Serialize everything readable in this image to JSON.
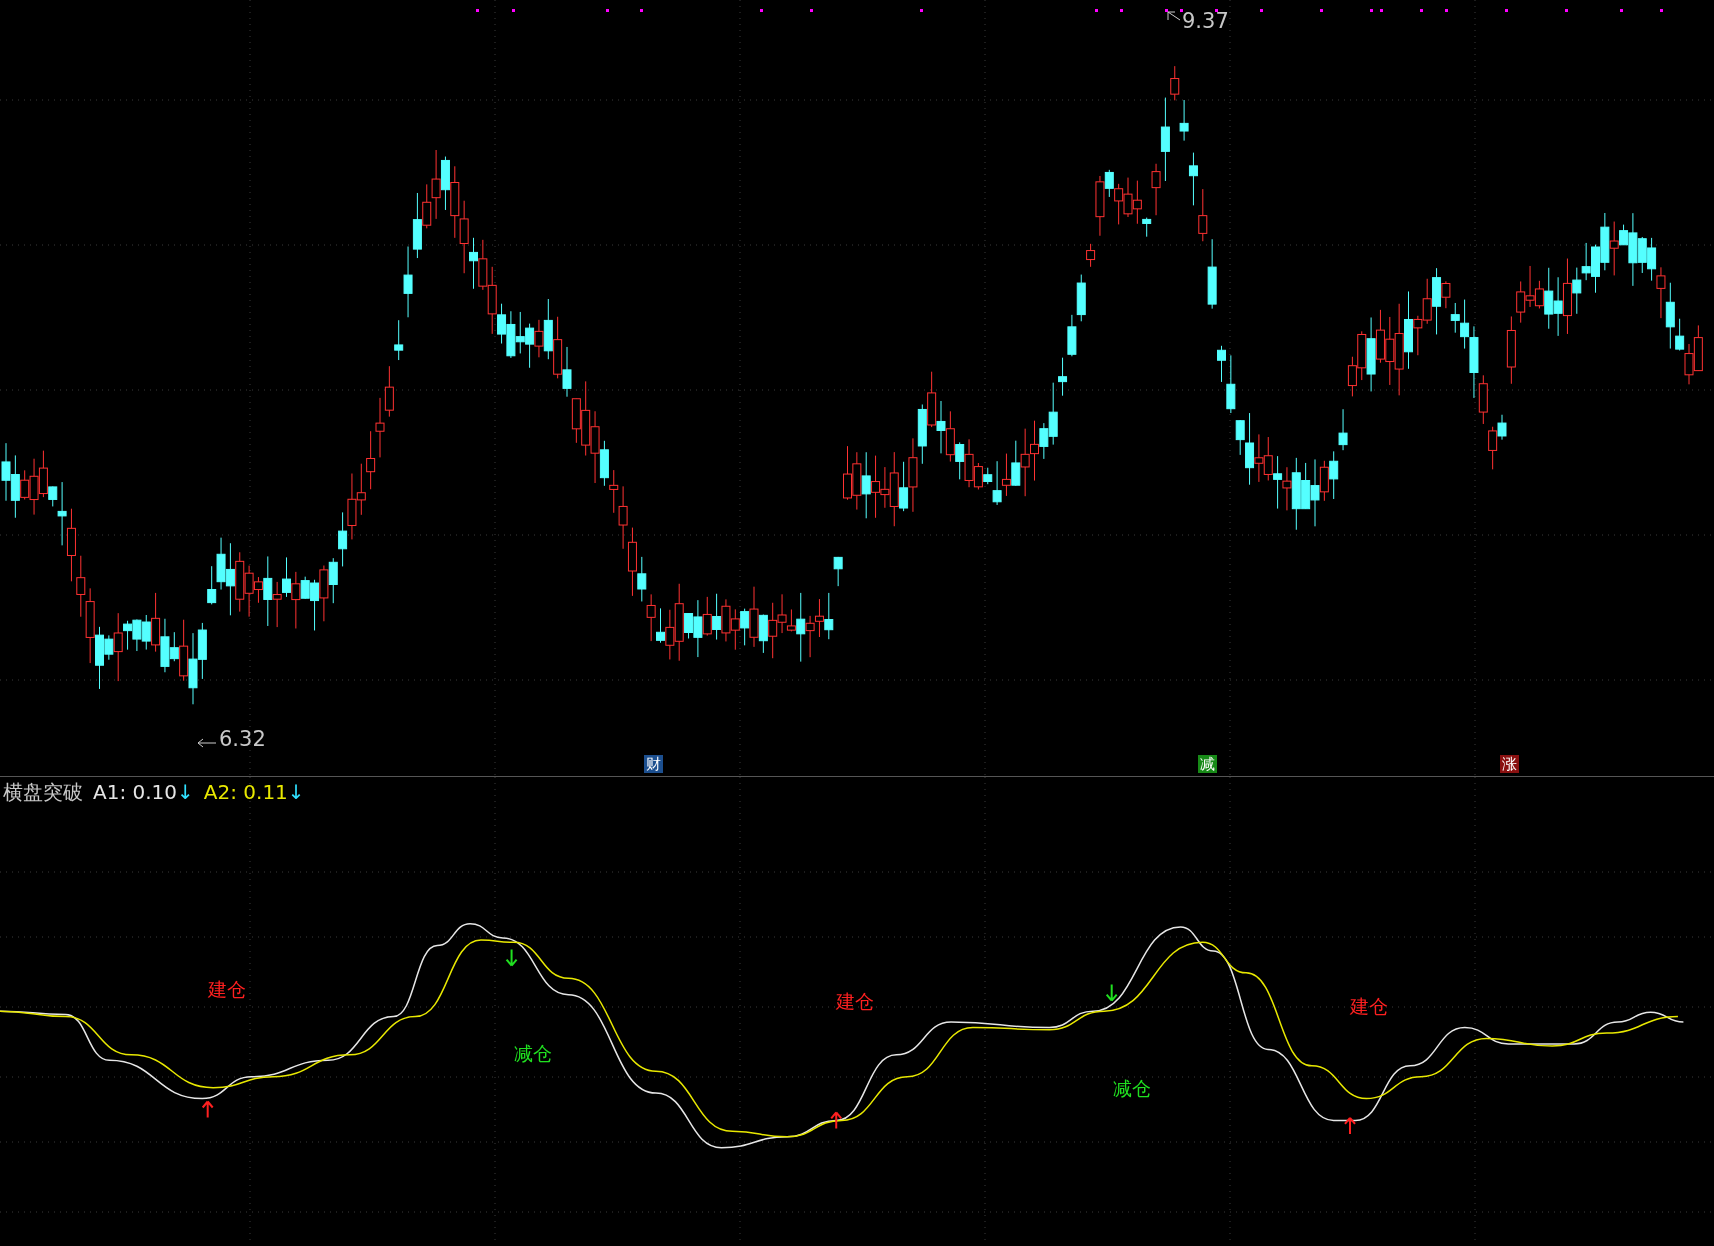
{
  "price_chart": {
    "high_label": "9.37",
    "low_label": "6.32",
    "markers": [
      {
        "text": "财",
        "color": "#1c4f8f"
      },
      {
        "text": "减",
        "color": "#178a17"
      },
      {
        "text": "涨",
        "color": "#8a1010"
      }
    ]
  },
  "indicator": {
    "name": "横盘突破",
    "lines": [
      {
        "label": "A1: 0.10",
        "arrow": "↓",
        "color": "#e6e6e6"
      },
      {
        "label": "A2: 0.11",
        "arrow": "↓",
        "color": "#e8e800"
      }
    ],
    "signals": [
      {
        "kind": "buy",
        "text": "建仓"
      },
      {
        "kind": "sell",
        "text": "减仓"
      },
      {
        "kind": "buy",
        "text": "建仓"
      },
      {
        "kind": "sell",
        "text": "减仓"
      },
      {
        "kind": "buy",
        "text": "建仓"
      }
    ]
  }
}
